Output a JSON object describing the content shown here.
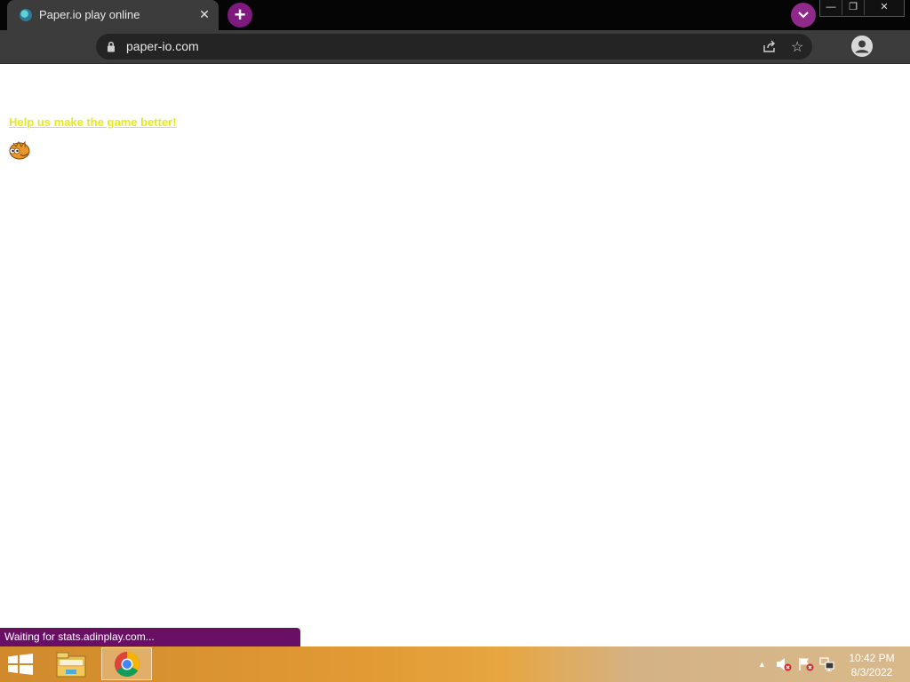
{
  "browser": {
    "tab": {
      "title": "Paper.io play online",
      "close_glyph": "✕"
    },
    "new_tab_glyph": "+",
    "address": {
      "url": "paper-io.com"
    },
    "window_controls": {
      "minimize": "—",
      "restore": "❐",
      "close": "✕"
    },
    "accent_color": "#7e1a7e"
  },
  "page": {
    "help_link": "Help us make the game better!",
    "help_link_color": "#e5ea1a"
  },
  "status_bar": {
    "text": "Waiting for stats.adinplay.com...",
    "color": "#6a0f66"
  },
  "taskbar": {
    "apps": [
      "start-icon",
      "file-explorer-icon",
      "chrome-icon"
    ],
    "clock": {
      "time": "10:42 PM",
      "date": "8/3/2022"
    }
  }
}
